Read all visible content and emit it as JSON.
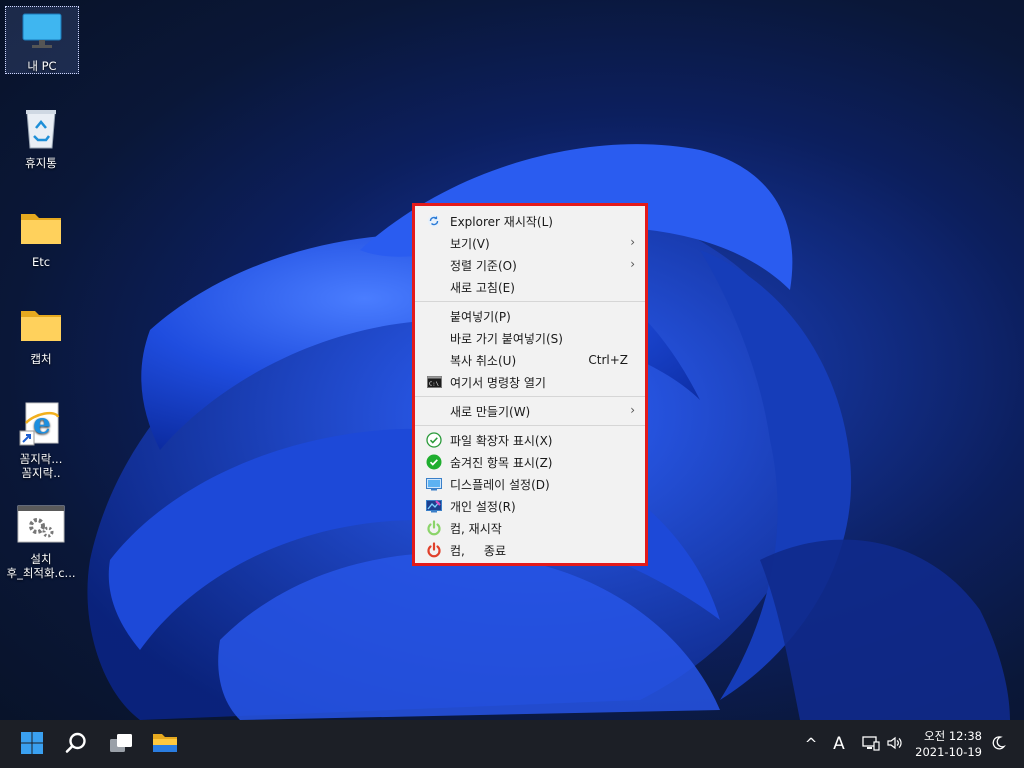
{
  "desktop": {
    "icons": [
      {
        "label": "내 PC",
        "icon": "monitor-icon"
      },
      {
        "label": "휴지통",
        "icon": "recycle-bin-icon"
      },
      {
        "label": "Etc",
        "icon": "folder-icon"
      },
      {
        "label": "캡처",
        "icon": "folder-icon"
      },
      {
        "label": "꼼지락...",
        "label2": "꼼지락..",
        "icon": "internet-explorer-shortcut-icon"
      },
      {
        "label": "설치",
        "label2": "후_최적화.c...",
        "icon": "settings-gears-icon"
      }
    ]
  },
  "context_menu": {
    "groups": [
      [
        {
          "label": "Explorer 재시작(L)",
          "icon": "refresh-icon"
        },
        {
          "label": "보기(V)",
          "submenu": true
        },
        {
          "label": "정렬 기준(O)",
          "submenu": true
        },
        {
          "label": "새로 고침(E)"
        }
      ],
      [
        {
          "label": "붙여넣기(P)"
        },
        {
          "label": "바로 가기 붙여넣기(S)"
        },
        {
          "label": "복사 취소(U)",
          "shortcut": "Ctrl+Z"
        },
        {
          "label": "여기서 명령창 열기",
          "icon": "command-prompt-icon"
        }
      ],
      [
        {
          "label": "새로 만들기(W)",
          "submenu": true
        }
      ],
      [
        {
          "label": "파일 확장자 표시(X)",
          "icon": "check-circle-outline-icon"
        },
        {
          "label": "숨겨진 항목 표시(Z)",
          "icon": "check-circle-filled-icon"
        },
        {
          "label": "디스플레이 설정(D)",
          "icon": "display-icon"
        },
        {
          "label": "개인 설정(R)",
          "icon": "personalize-icon"
        },
        {
          "label": "컴, 재시작",
          "icon": "power-green-icon"
        },
        {
          "label": "컴,     종료",
          "icon": "power-red-icon"
        }
      ]
    ]
  },
  "taskbar": {
    "buttons": [
      "start-icon",
      "search-icon",
      "task-view-icon",
      "file-explorer-icon"
    ],
    "tray": {
      "chevron": "^",
      "ime": "A",
      "time": "오전 12:38",
      "date": "2021-10-19"
    }
  },
  "colors": {
    "highlight_border": "#e31b1b",
    "taskbar": "#1c1f26",
    "menu_bg": "#f2f2f2"
  }
}
